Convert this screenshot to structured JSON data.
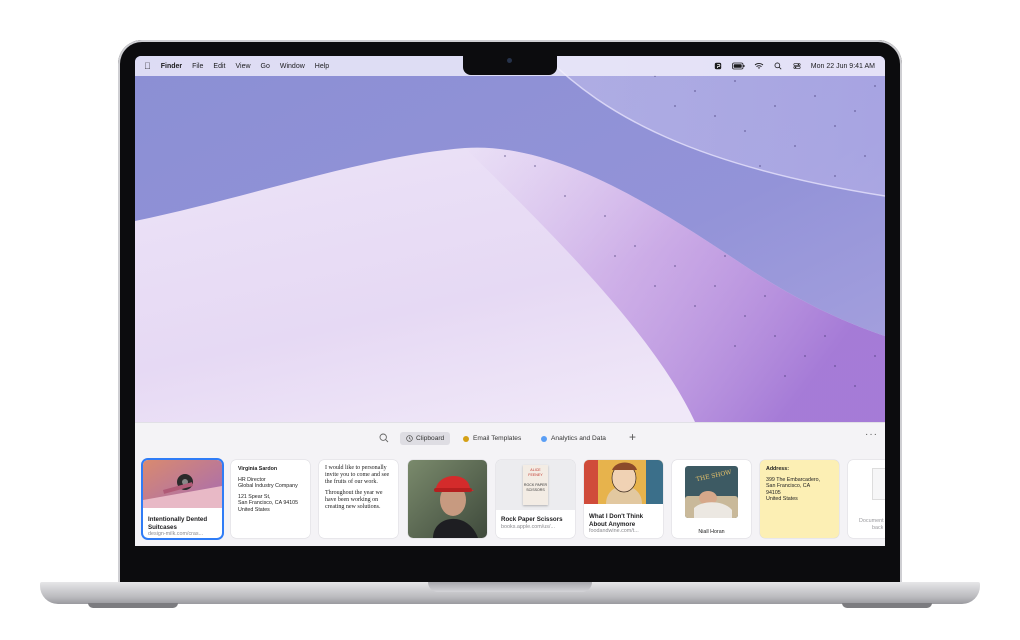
{
  "menubar": {
    "app": "Finder",
    "items": [
      "File",
      "Edit",
      "View",
      "Go",
      "Window",
      "Help"
    ],
    "datetime": "Mon 22 Jun  9:41 AM"
  },
  "toolbar": {
    "tabs": [
      {
        "label": "Clipboard",
        "color": ""
      },
      {
        "label": "Email Templates",
        "color": "#d4a016"
      },
      {
        "label": "Analytics and Data",
        "color": "#5a9ef5"
      }
    ]
  },
  "cards": {
    "link1": {
      "title": "Intentionally Dented Suitcases",
      "url": "design-milk.com/cras..."
    },
    "contact": {
      "name": "Virginia Sardon",
      "role": "HR Director",
      "company": "Global Industry Company",
      "street": "121 Spear St,",
      "city": "San Francisco, CA 94105",
      "country": "United States"
    },
    "letter": {
      "p1": "I would like to personally invite you to come and see the fruits of our work.",
      "p2": "Throughout the year we have been working on creating new solutions."
    },
    "book": {
      "title": "Rock Paper Scissors",
      "url": "books.apple.com/us/...",
      "cover_top": "ALICE FEENEY",
      "cover_mid": "ROCK PAPER SCISSORS"
    },
    "article": {
      "title": "What I Don't Think About Anymore",
      "url": "foodandwine.com/t..."
    },
    "person": {
      "name": "Niall Horan",
      "album": "THE SHOW"
    },
    "address": {
      "label": "Address:",
      "line1": "399 The Embarcadero,",
      "line2": "San Francisco, CA",
      "line3": "94105",
      "line4": "United States"
    },
    "doc": {
      "label1": "Document",
      "label2": "back"
    }
  }
}
